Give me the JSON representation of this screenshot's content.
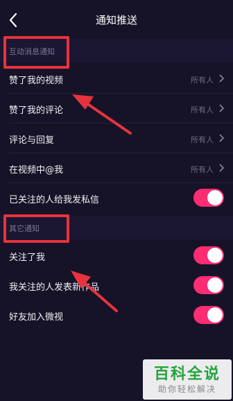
{
  "header": {
    "title": "通知推送"
  },
  "sections": [
    {
      "label": "互动消息通知",
      "rows": [
        {
          "label": "赞了我的视频",
          "value": "所有人"
        },
        {
          "label": "赞了我的评论",
          "value": "所有人"
        },
        {
          "label": "评论与回复",
          "value": "所有人"
        },
        {
          "label": "在视频中@我",
          "value": "所有人"
        },
        {
          "label": "已关注的人给我发私信",
          "toggle_on": true
        }
      ]
    },
    {
      "label": "其它通知",
      "rows": [
        {
          "label": "关注了我",
          "toggle_on": true
        },
        {
          "label": "我关注的人发表新作品",
          "toggle_on": true
        },
        {
          "label": "好友加入微视",
          "toggle_on": true
        }
      ]
    }
  ],
  "watermark": {
    "title": "百科全说",
    "subtitle": "助你轻松解决"
  },
  "colors": {
    "accent": "#fe2c72",
    "background": "#161328",
    "annotation": "#e8333c"
  }
}
